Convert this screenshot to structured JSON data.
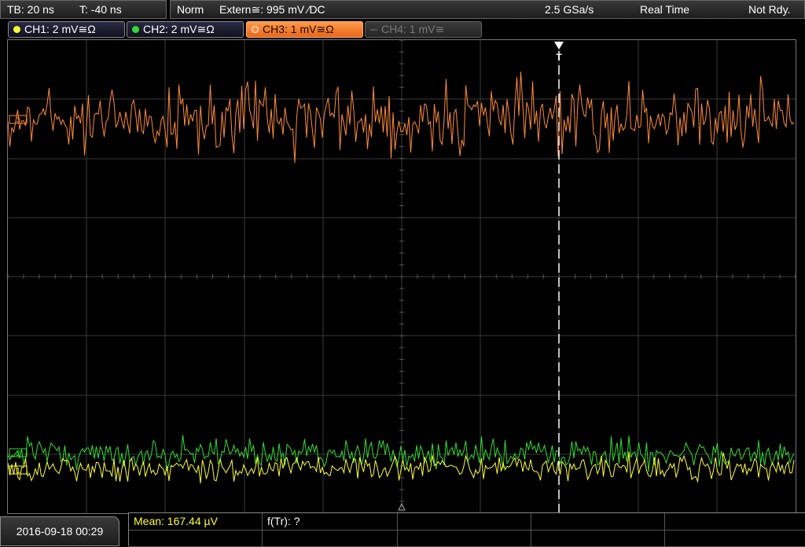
{
  "topbar": {
    "timebase": "TB: 20 ns",
    "trigger_time": "T: -40 ns",
    "mode": "Norm",
    "trigger_source": "Extern≅: 995 mV ⁄DC",
    "sample_rate": "2.5 GSa/s",
    "acquisition": "Real Time",
    "trigger_status": "Not Rdy."
  },
  "channels": [
    {
      "label": "CH1: 2 mV≅Ω",
      "color": "#ffff33",
      "state": "on"
    },
    {
      "label": "CH2: 2 mV≅Ω",
      "color": "#33dd33",
      "state": "on"
    },
    {
      "label": "CH3: 1 mV≅Ω",
      "color": "#ff8c3a",
      "state": "active"
    },
    {
      "label": "CH4: 1 mV≅",
      "color": "#777777",
      "state": "off"
    }
  ],
  "markers": {
    "ch3": "3",
    "ch2": "2",
    "ch1": "1",
    "trigger": "T"
  },
  "datetime": "2016-09-18 00:29",
  "measurements": {
    "mean": "Mean: 167.44 µV",
    "ftr": "f(Tr): ?"
  },
  "colors": {
    "grid": "#3a3a3a",
    "ch1": "#ffff33",
    "ch2": "#33dd33",
    "ch3": "#ff8c3a",
    "trigger_line": "#ffffff"
  }
}
